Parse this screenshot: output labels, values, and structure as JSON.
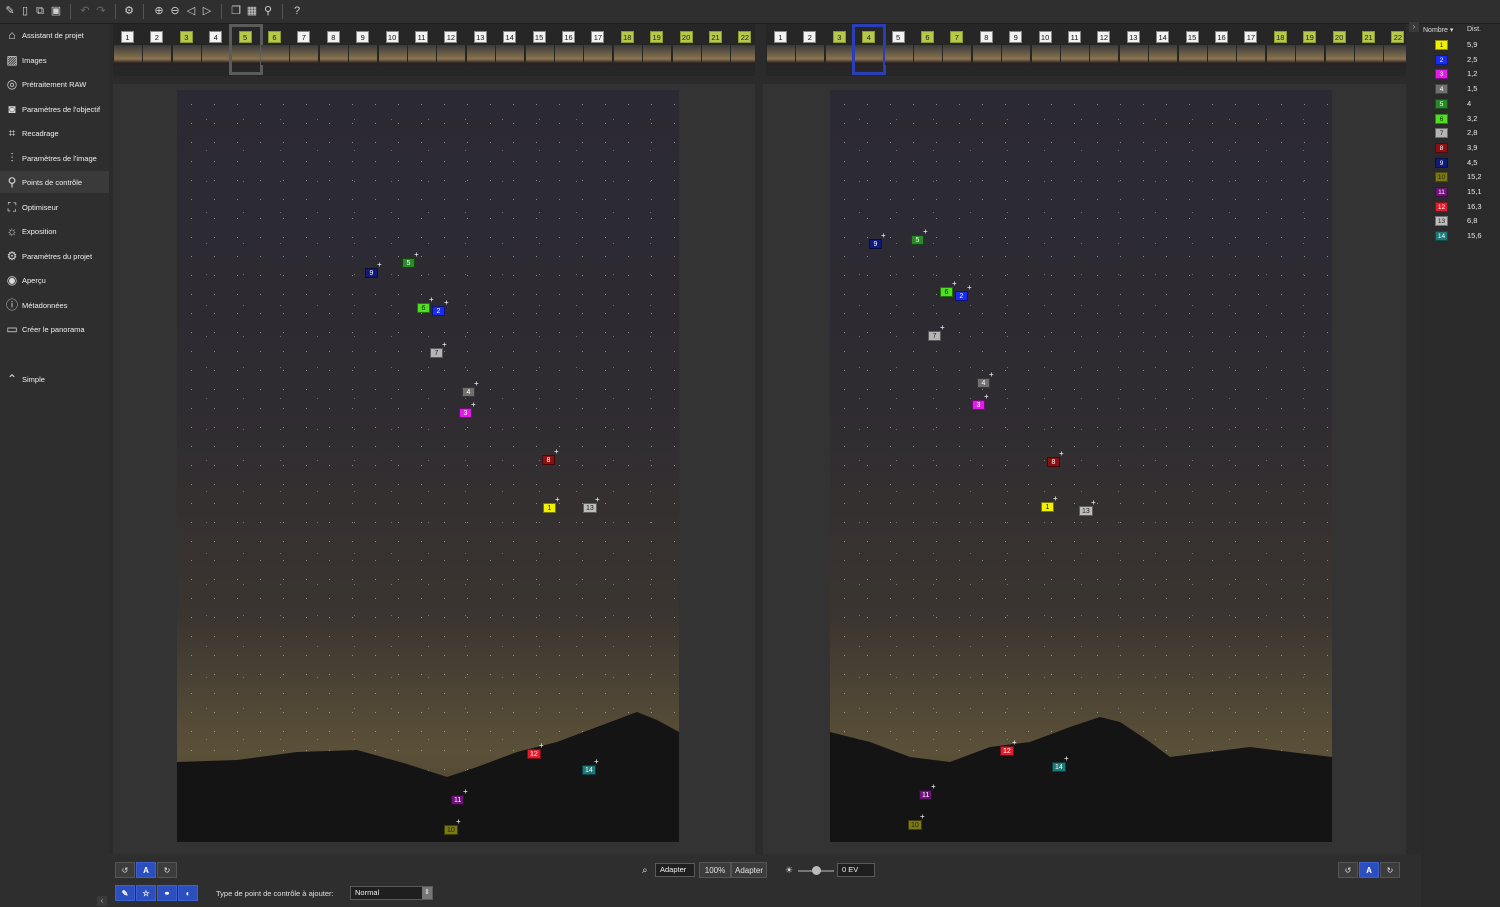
{
  "toolbar": {
    "icons": [
      "edit-icon",
      "new-project-icon",
      "duplicate-icon",
      "save-icon",
      "undo-icon",
      "redo-icon",
      "settings-gear-icon",
      "zoom-in-icon",
      "zoom-out-icon",
      "previous-icon",
      "next-icon",
      "windows-icon",
      "grid-icon",
      "pin-icon",
      "help-icon"
    ]
  },
  "sidebar": {
    "items": [
      {
        "label": "Assistant de projet",
        "icon": "home-icon"
      },
      {
        "label": "Images",
        "icon": "images-icon"
      },
      {
        "label": "Prétraitement RAW",
        "icon": "raw-icon"
      },
      {
        "label": "Paramètres de l'objectif",
        "icon": "camera-icon"
      },
      {
        "label": "Recadrage",
        "icon": "crop-icon"
      },
      {
        "label": "Paramètres de l'image",
        "icon": "sliders-icon"
      },
      {
        "label": "Points de contrôle",
        "icon": "control-points-icon"
      },
      {
        "label": "Optimiseur",
        "icon": "optimizer-icon"
      },
      {
        "label": "Exposition",
        "icon": "sun-icon"
      },
      {
        "label": "Paramètres du projet",
        "icon": "gear-icon"
      },
      {
        "label": "Aperçu",
        "icon": "eye-icon"
      },
      {
        "label": "Métadonnées",
        "icon": "info-icon"
      },
      {
        "label": "Créer le panorama",
        "icon": "panorama-icon"
      }
    ],
    "simple_label": "Simple"
  },
  "strip_left": {
    "thumbs": [
      "1",
      "2",
      "3",
      "4",
      "5",
      "6",
      "7",
      "8",
      "9",
      "10",
      "11",
      "12",
      "13",
      "14",
      "15",
      "16",
      "17",
      "18",
      "19",
      "20",
      "21",
      "22"
    ],
    "highlighted": [
      "3",
      "5",
      "6",
      "18",
      "19",
      "20",
      "21",
      "22"
    ],
    "selected": "5"
  },
  "strip_right": {
    "thumbs": [
      "1",
      "2",
      "3",
      "4",
      "5",
      "6",
      "7",
      "8",
      "9",
      "10",
      "11",
      "12",
      "13",
      "14",
      "15",
      "16",
      "17",
      "18",
      "19",
      "20",
      "21",
      "22"
    ],
    "highlighted": [
      "3",
      "4",
      "6",
      "7",
      "18",
      "19",
      "20",
      "21",
      "22"
    ],
    "selected": "4"
  },
  "control_points": [
    {
      "id": "1",
      "color": "#f0f000",
      "text": "#222",
      "dist": "5,9"
    },
    {
      "id": "2",
      "color": "#1a2cf0",
      "text": "#fff",
      "dist": "2,5"
    },
    {
      "id": "3",
      "color": "#e11ce6",
      "text": "#fff",
      "dist": "1,2"
    },
    {
      "id": "4",
      "color": "#707070",
      "text": "#fff",
      "dist": "1,5"
    },
    {
      "id": "5",
      "color": "#2a8a2a",
      "text": "#fff",
      "dist": "4"
    },
    {
      "id": "6",
      "color": "#4ee020",
      "text": "#222",
      "dist": "3,2"
    },
    {
      "id": "7",
      "color": "#b5b5b5",
      "text": "#222",
      "dist": "2,8"
    },
    {
      "id": "8",
      "color": "#8a1111",
      "text": "#fff",
      "dist": "3,9"
    },
    {
      "id": "9",
      "color": "#101a78",
      "text": "#fff",
      "dist": "4,5"
    },
    {
      "id": "10",
      "color": "#7a7a10",
      "text": "#222",
      "dist": "15,2"
    },
    {
      "id": "11",
      "color": "#6e1378",
      "text": "#fff",
      "dist": "15,1"
    },
    {
      "id": "12",
      "color": "#e41d2d",
      "text": "#fff",
      "dist": "16,3"
    },
    {
      "id": "13",
      "color": "#bdbdbd",
      "text": "#222",
      "dist": "6,8"
    },
    {
      "id": "14",
      "color": "#1e7a7a",
      "text": "#fff",
      "dist": "15,6"
    }
  ],
  "list": {
    "header_number": "Nombre ▾",
    "header_dist": "Dist."
  },
  "bottom": {
    "rotate_left_icon": "rotate-left-icon",
    "auto_label": "A",
    "rotate_right_icon": "rotate-right-icon",
    "zoom_icon": "magnifier-icon",
    "fit_left_label": "Adapter",
    "zoom_label": "100%",
    "fit_right_label": "Adapter",
    "exposure_value": "0 EV",
    "cp_type_label": "Type de point de contrôle à ajouter:",
    "cp_type_value": "Normal"
  }
}
